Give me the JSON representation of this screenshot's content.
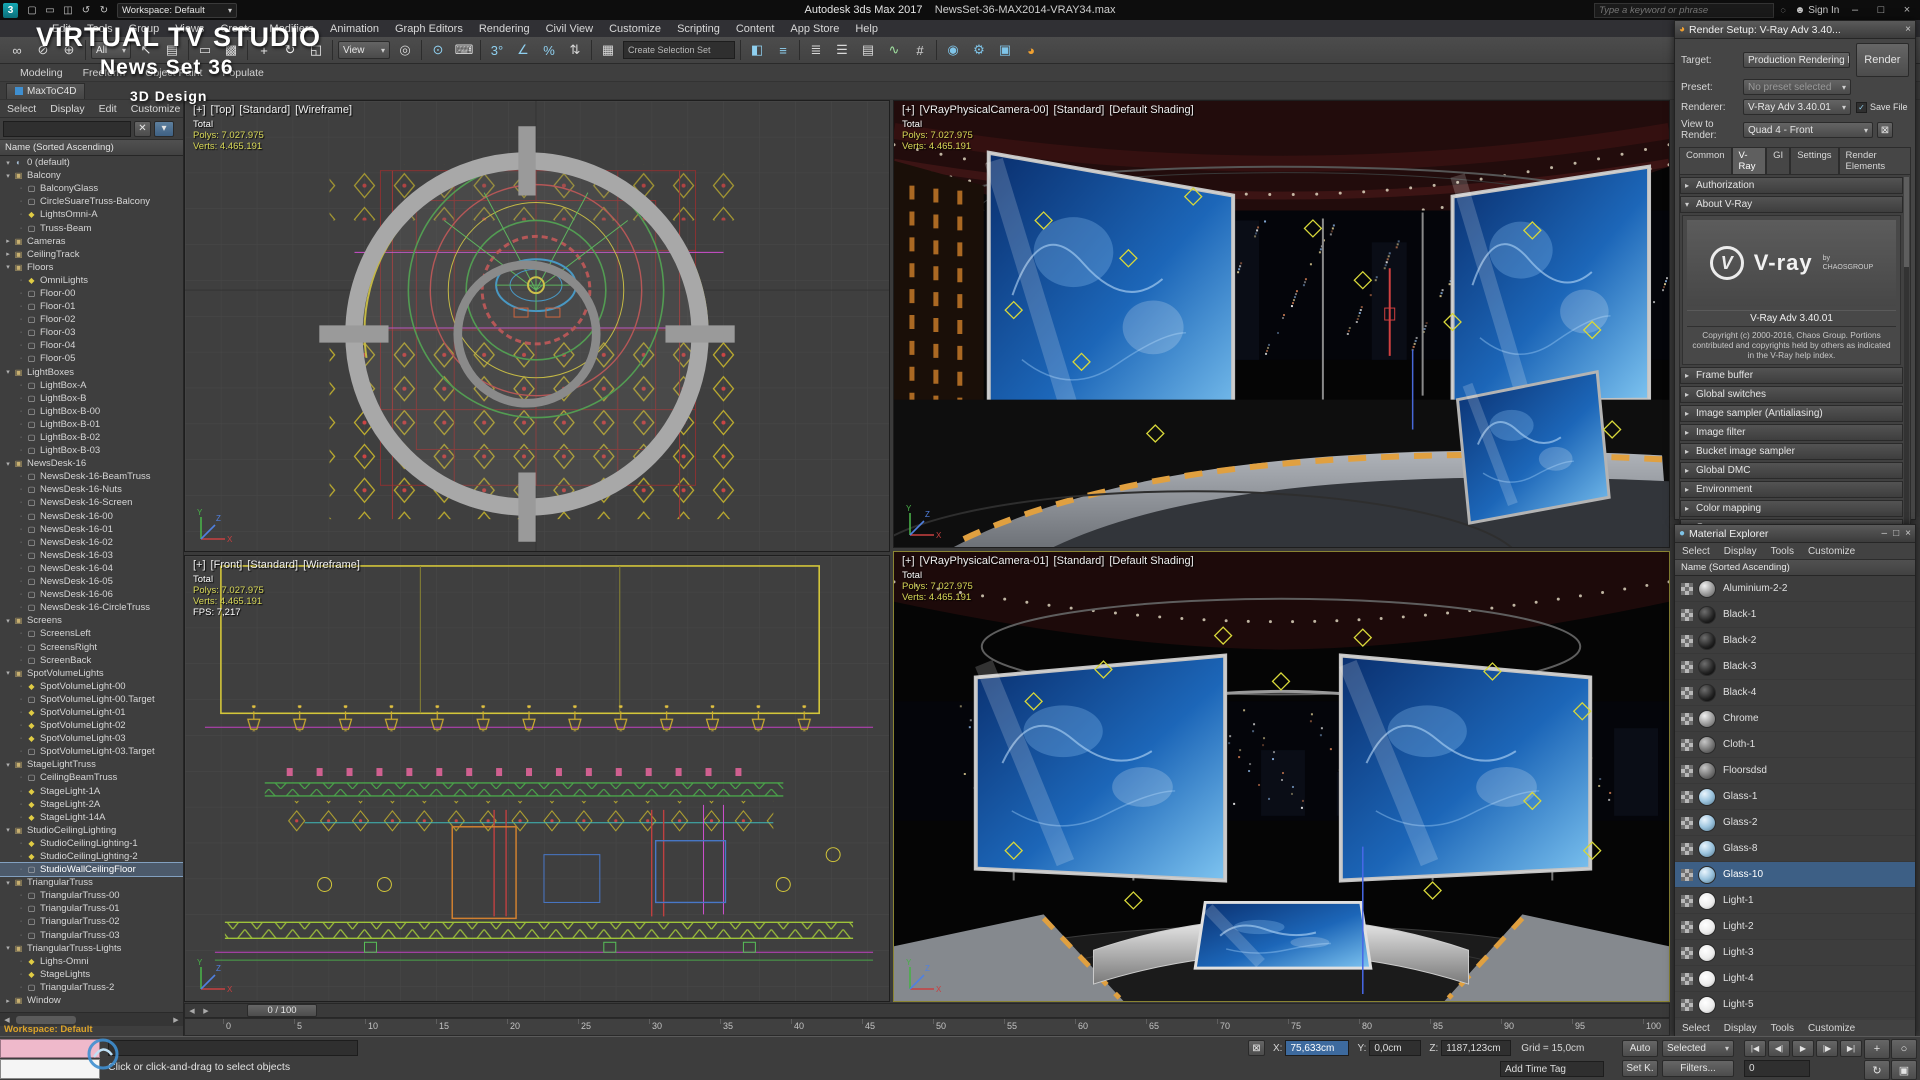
{
  "colors": {
    "accent_blue": "#3f8fd0",
    "selection_bg": "#3d5f85",
    "stats_yellow": "#d8d858",
    "viewport_bg": "#3f3f3f",
    "autodesk_teal": "#15a8b4"
  },
  "titlebar": {
    "app_button": "3",
    "workspace": "Workspace: Default",
    "app_title": "Autodesk 3ds Max 2017",
    "file_name": "NewsSet-36-MAX2014-VRAY34.max",
    "search_placeholder": "Type a keyword or phrase",
    "sign_in": "Sign In",
    "quick_icons": [
      [
        "new-file-icon",
        "▢"
      ],
      [
        "open-file-icon",
        "▭"
      ],
      [
        "save-file-icon",
        "◫"
      ],
      [
        "undo-icon",
        "↺"
      ],
      [
        "redo-icon",
        "↻"
      ]
    ],
    "window_buttons": [
      [
        "minimize-icon",
        "–"
      ],
      [
        "restore-icon",
        "□"
      ],
      [
        "close-icon",
        "×"
      ]
    ]
  },
  "menubar": [
    "Edit",
    "Tools",
    "Group",
    "Views",
    "Create",
    "Modifiers",
    "Animation",
    "Graph Editors",
    "Rendering",
    "Civil View",
    "Customize",
    "Scripting",
    "Content",
    "App Store",
    "Help"
  ],
  "ribbon": {
    "tabs": [
      "Modeling",
      "Freeform",
      "Object Paint",
      "Populate"
    ],
    "tab2": "MaxToC4D"
  },
  "watermark": {
    "line1": "VIRTUAL TV STUDIO",
    "line2": "News Set 36",
    "line3": "3D Design"
  },
  "toolbar": {
    "icons": [
      [
        "select-and-link-icon",
        "∞",
        "#d8d8d8"
      ],
      [
        "unlink-selection-icon",
        "⊘",
        "#d8d8d8"
      ],
      [
        "bind-to-space-warp-icon",
        "⊕",
        "#d8d8d8"
      ],
      [
        "sep"
      ],
      [
        "selection-filter-dropdown",
        "All",
        "#e6e6e6",
        40,
        "drop"
      ],
      [
        "select-object-icon",
        "↖",
        "#efefef"
      ],
      [
        "select-by-name-icon",
        "▤",
        "#d8d8d8"
      ],
      [
        "sep"
      ],
      [
        "selection-region-icon",
        "▭",
        "#d8d8d8"
      ],
      [
        "window-crossing-icon",
        "▩",
        "#d8d8d8"
      ],
      [
        "sep"
      ],
      [
        "select-and-move-icon",
        "+",
        "#efefef"
      ],
      [
        "select-and-rotate-icon",
        "↻",
        "#efefef"
      ],
      [
        "select-and-scale-icon",
        "◱",
        "#efefef"
      ],
      [
        "sep"
      ],
      [
        "reference-coordinate-dropdown",
        "View",
        "#e6e6e6",
        52,
        "drop"
      ],
      [
        "use-pivot-center-icon",
        "◎",
        "#d8d8d8"
      ],
      [
        "sep"
      ],
      [
        "select-and-manipulate-icon",
        "⊙",
        "#8fd0f0"
      ],
      [
        "keyboard-override-icon",
        "⌨",
        "#d8d8d8"
      ],
      [
        "sep"
      ],
      [
        "snap-toggle-3d-icon",
        "3°",
        "#8fd0f0"
      ],
      [
        "angle-snap-icon",
        "∠",
        "#8fd0f0"
      ],
      [
        "percent-snap-icon",
        "%",
        "#8fd0f0"
      ],
      [
        "spinner-snap-icon",
        "⇅",
        "#d8d8d8"
      ],
      [
        "sep"
      ],
      [
        "edit-named-selection-icon",
        "▦",
        "#d8d8d8"
      ],
      [
        "named-selection-set-field",
        "Create Selection Set",
        "#b8b8b8",
        112,
        "field"
      ],
      [
        "sep"
      ],
      [
        "mirror-icon",
        "◧",
        "#8fd0f0"
      ],
      [
        "align-icon",
        "≡",
        "#8fd0f0"
      ],
      [
        "sep"
      ],
      [
        "toggle-scene-explorer-icon",
        "≣",
        "#d8d8d8"
      ],
      [
        "layer-manager-icon",
        "☰",
        "#d8d8d8"
      ],
      [
        "graphite-ribbon-icon",
        "▤",
        "#d8d8d8"
      ],
      [
        "curve-editor-icon",
        "∿",
        "#9fe09f"
      ],
      [
        "schematic-view-icon",
        "#",
        "#d8d8d8"
      ],
      [
        "sep"
      ],
      [
        "material-editor-icon",
        "◉",
        "#7fc4e8"
      ],
      [
        "render-setup-icon",
        "⚙",
        "#7fc4e8"
      ],
      [
        "rendered-frame-window-icon",
        "▣",
        "#7fc4e8"
      ],
      [
        "render-production-icon",
        "◕",
        "#f0a030"
      ]
    ]
  },
  "scene_explorer": {
    "menus": [
      "Select",
      "Display",
      "Edit",
      "Customize"
    ],
    "column_header": "Name (Sorted Ascending)",
    "items": [
      [
        "0 (default)",
        0,
        "la",
        "e"
      ],
      [
        "Balcony",
        0,
        "g",
        "e"
      ],
      [
        "BalconyGlass",
        1,
        "o"
      ],
      [
        "CircleSuareTruss-Balcony",
        1,
        "o"
      ],
      [
        "LightsOmni-A",
        1,
        "li"
      ],
      [
        "Truss-Beam",
        1,
        "o"
      ],
      [
        "Cameras",
        0,
        "g",
        "c"
      ],
      [
        "CeilingTrack",
        0,
        "g",
        "c"
      ],
      [
        "Floors",
        0,
        "g",
        "e"
      ],
      [
        "OmniLights",
        1,
        "li"
      ],
      [
        "Floor-00",
        1,
        "o"
      ],
      [
        "Floor-01",
        1,
        "o"
      ],
      [
        "Floor-02",
        1,
        "o"
      ],
      [
        "Floor-03",
        1,
        "o"
      ],
      [
        "Floor-04",
        1,
        "o"
      ],
      [
        "Floor-05",
        1,
        "o"
      ],
      [
        "LightBoxes",
        0,
        "g",
        "e"
      ],
      [
        "LightBox-A",
        1,
        "o"
      ],
      [
        "LightBox-B",
        1,
        "o"
      ],
      [
        "LightBox-B-00",
        1,
        "o"
      ],
      [
        "LightBox-B-01",
        1,
        "o"
      ],
      [
        "LightBox-B-02",
        1,
        "o"
      ],
      [
        "LightBox-B-03",
        1,
        "o"
      ],
      [
        "NewsDesk-16",
        0,
        "g",
        "e"
      ],
      [
        "NewsDesk-16-BeamTruss",
        1,
        "o"
      ],
      [
        "NewsDesk-16-Nuts",
        1,
        "o"
      ],
      [
        "NewsDesk-16-Screen",
        1,
        "o"
      ],
      [
        "NewsDesk-16-00",
        1,
        "o"
      ],
      [
        "NewsDesk-16-01",
        1,
        "o"
      ],
      [
        "NewsDesk-16-02",
        1,
        "o"
      ],
      [
        "NewsDesk-16-03",
        1,
        "o"
      ],
      [
        "NewsDesk-16-04",
        1,
        "o"
      ],
      [
        "NewsDesk-16-05",
        1,
        "o"
      ],
      [
        "NewsDesk-16-06",
        1,
        "o"
      ],
      [
        "NewsDesk-16-CircleTruss",
        1,
        "o"
      ],
      [
        "Screens",
        0,
        "g",
        "e"
      ],
      [
        "ScreensLeft",
        1,
        "o"
      ],
      [
        "ScreensRight",
        1,
        "o"
      ],
      [
        "ScreenBack",
        1,
        "o"
      ],
      [
        "SpotVolumeLights",
        0,
        "g",
        "e"
      ],
      [
        "SpotVolumeLight-00",
        1,
        "li"
      ],
      [
        "SpotVolumeLight-00.Target",
        1,
        "o"
      ],
      [
        "SpotVolumeLight-01",
        1,
        "li"
      ],
      [
        "SpotVolumeLight-02",
        1,
        "li"
      ],
      [
        "SpotVolumeLight-03",
        1,
        "li"
      ],
      [
        "SpotVolumeLight-03.Target",
        1,
        "o"
      ],
      [
        "StageLightTruss",
        0,
        "g",
        "e"
      ],
      [
        "CeilingBeamTruss",
        1,
        "o"
      ],
      [
        "StageLight-1A",
        1,
        "li"
      ],
      [
        "StageLight-2A",
        1,
        "li"
      ],
      [
        "StageLight-14A",
        1,
        "li"
      ],
      [
        "StudioCeilingLighting",
        0,
        "g",
        "e"
      ],
      [
        "StudioCeilingLighting-1",
        1,
        "li"
      ],
      [
        "StudioCeilingLighting-2",
        1,
        "li"
      ],
      [
        "StudioWallCeilingFloor",
        1,
        "o",
        "s"
      ],
      [
        "TriangularTruss",
        0,
        "g",
        "e"
      ],
      [
        "TriangularTruss-00",
        1,
        "o"
      ],
      [
        "TriangularTruss-01",
        1,
        "o"
      ],
      [
        "TriangularTruss-02",
        1,
        "o"
      ],
      [
        "TriangularTruss-03",
        1,
        "o"
      ],
      [
        "TriangularTruss-Lights",
        0,
        "g",
        "e"
      ],
      [
        "Lighs-Omni",
        1,
        "li"
      ],
      [
        "StageLights",
        1,
        "li"
      ],
      [
        "TriangularTruss-2",
        1,
        "o"
      ],
      [
        "Window",
        0,
        "g",
        "c"
      ]
    ]
  },
  "viewports": {
    "top": {
      "menu_btn": "[+]",
      "name": "[Top]",
      "style": "[Standard]",
      "shading": "[Wireframe]",
      "total": "Total",
      "polys": "Polys: 7.027.975",
      "verts": "Verts: 4.465.191"
    },
    "front": {
      "menu_btn": "[+]",
      "name": "[Front]",
      "style": "[Standard]",
      "shading": "[Wireframe]",
      "total": "Total",
      "polys": "Polys: 7.027.975",
      "verts": "Verts: 4.465.191",
      "fps": "FPS: 7,217"
    },
    "cam00": {
      "menu_btn": "[+]",
      "name": "[VRayPhysicalCamera-00]",
      "style": "[Standard]",
      "shading": "[Default Shading]",
      "total": "Total",
      "polys": "Polys: 7.027.975",
      "verts": "Verts: 4.465.191"
    },
    "cam01": {
      "menu_btn": "[+]",
      "name": "[VRayPhysicalCamera-01]",
      "style": "[Standard]",
      "shading": "[Default Shading]",
      "total": "Total",
      "polys": "Polys: 7.027.975",
      "verts": "Verts: 4.465.191"
    }
  },
  "viewport_chrome": {
    "axis_labels": [
      "X",
      "Y",
      "Z"
    ]
  },
  "render_setup": {
    "title": "Render Setup: V-Ray Adv 3.40...",
    "target_label": "Target:",
    "target_value": "Production Rendering Mode",
    "render_button": "Render",
    "preset_label": "Preset:",
    "preset_value": "No preset selected",
    "renderer_label": "Renderer:",
    "renderer_value": "V-Ray Adv 3.40.01",
    "save_file": "Save File",
    "save_check": "✓",
    "view_label": "View to Render:",
    "view_value": "Quad 4 - Front",
    "tabs": [
      "Common",
      "V-Ray",
      "GI",
      "Settings",
      "Render Elements"
    ],
    "active_tab": "V-Ray",
    "rollout_authorization": "Authorization",
    "rollout_about": "About V-Ray",
    "logo_text": "V-ray",
    "logo_v": "V",
    "logo_by_1": "by",
    "logo_by_2": "CHAOSGROUP",
    "about_version": "V-Ray Adv 3.40.01",
    "about_copyright": "Copyright (c) 2000-2016, Chaos Group. Portions contributed and copyrights held by others as indicated in the V-Ray help index.",
    "rollouts": [
      "Frame buffer",
      "Global switches",
      "Image sampler (Antialiasing)",
      "Image filter",
      "Bucket image sampler",
      "Global DMC",
      "Environment",
      "Color mapping",
      "Camera"
    ]
  },
  "material_explorer": {
    "title": "Material Explorer",
    "menus": [
      "Select",
      "Display",
      "Tools",
      "Customize"
    ],
    "column_header": "Name (Sorted Ascending)",
    "materials": [
      [
        "Aluminium-2-2",
        "metal"
      ],
      [
        "Black-1",
        "dark"
      ],
      [
        "Black-2",
        "dark"
      ],
      [
        "Black-3",
        "dark"
      ],
      [
        "Black-4",
        "dark"
      ],
      [
        "Chrome",
        "metal"
      ],
      [
        "Cloth-1",
        "gray"
      ],
      [
        "Floorsdsd",
        "gray"
      ],
      [
        "Glass-1",
        "glass"
      ],
      [
        "Glass-2",
        "glass"
      ],
      [
        "Glass-8",
        "glass"
      ],
      [
        "Glass-10",
        "glass",
        "s"
      ],
      [
        "Light-1",
        "light"
      ],
      [
        "Light-2",
        "light"
      ],
      [
        "Light-3",
        "light"
      ],
      [
        "Light-4",
        "light"
      ],
      [
        "Light-5",
        "light"
      ]
    ],
    "bottom_menus": [
      "Select",
      "Display",
      "Tools",
      "Customize"
    ]
  },
  "timeline": {
    "time_field": "0 / 100",
    "ticks": [
      "0",
      "5",
      "10",
      "15",
      "20",
      "25",
      "30",
      "35",
      "40",
      "45",
      "50",
      "55",
      "60",
      "65",
      "70",
      "75",
      "80",
      "85",
      "90",
      "95",
      "100"
    ]
  },
  "statusbar": {
    "workspace_note": "Workspace: Default",
    "status_line": "Click or click-and-drag to select objects",
    "add_time_tag": "Add Time Tag",
    "x_label": "X:",
    "x_value": "75,633cm",
    "y_label": "Y:",
    "y_value": "0,0cm",
    "z_label": "Z:",
    "z_value": "1187,123cm",
    "grid_label": "Grid = 15,0cm",
    "auto_key": "Auto",
    "selected_dropdown": "Selected",
    "set_key": "Set K.",
    "filters": "Filters...",
    "frame_field": "0",
    "transport": [
      [
        "go-to-start-icon",
        "|◀"
      ],
      [
        "previous-frame-icon",
        "◀|"
      ],
      [
        "play-icon",
        "▶"
      ],
      [
        "next-frame-icon",
        "|▶"
      ],
      [
        "go-to-end-icon",
        "▶|"
      ]
    ],
    "nav": [
      [
        "pan-icon",
        "+"
      ],
      [
        "zoom-icon",
        "○"
      ],
      [
        "orbit-icon",
        "↻"
      ],
      [
        "maximize-viewport-icon",
        "▣"
      ]
    ]
  }
}
